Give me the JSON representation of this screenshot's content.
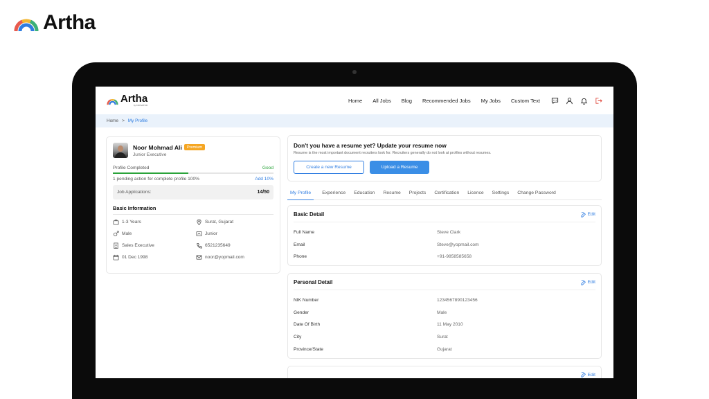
{
  "brand": {
    "name": "Artha"
  },
  "app": {
    "logo": {
      "name": "Artha",
      "sub": "by KNOVATOR"
    },
    "nav": [
      "Home",
      "All Jobs",
      "Blog",
      "Recommended Jobs",
      "My Jobs",
      "Custom Text"
    ],
    "nav_icons": [
      "chat-icon",
      "user-icon",
      "bell-icon",
      "logout-icon"
    ],
    "breadcrumb": {
      "home": "Home",
      "separator": ">",
      "current": "My Profile"
    },
    "colors": {
      "accent": "#2f7de1",
      "good": "#2aa33a",
      "premium": "#f5a623",
      "breadcrumb_bg": "#eaf2fb"
    }
  },
  "profile": {
    "name": "Noor Mohmad Ali",
    "badge": "Premium",
    "role": "Junior Executive",
    "completed_label": "Profile Completed",
    "completed_status": "Good",
    "completed_fraction": 0.47,
    "pending_text": "1 pending action for complete profile 100%",
    "add_text": "Add 10%",
    "job_apps_label": "Job Applications:",
    "job_apps_value": "14/50",
    "basic_info_title": "Basic Information",
    "basic_info": [
      {
        "icon": "briefcase-icon",
        "text": "1-3 Years"
      },
      {
        "icon": "location-icon",
        "text": "Surat, Gujarat"
      },
      {
        "icon": "gender-male-icon",
        "text": "Male"
      },
      {
        "icon": "level-icon",
        "text": "Junior"
      },
      {
        "icon": "building-icon",
        "text": "Sales Executive"
      },
      {
        "icon": "phone-icon",
        "text": "6521235649"
      },
      {
        "icon": "calendar-icon",
        "text": "01 Dec 1998"
      },
      {
        "icon": "mail-icon",
        "text": "noor@yopmail.com"
      }
    ]
  },
  "resume": {
    "title": "Don't you have a resume yet? Update your resume now",
    "subtitle": "Resume is the most important document recruiters look for. Recruiters generally do not look at profiles without resumes.",
    "create_button": "Create a new Resume",
    "upload_button": "Upload a Resume"
  },
  "tabs": [
    "My Profile",
    "Experience",
    "Education",
    "Resume",
    "Projects",
    "Certification",
    "Licence",
    "Settings",
    "Change Password"
  ],
  "basic_detail": {
    "title": "Basic Detail",
    "edit": "Edit",
    "rows": [
      {
        "label": "Full Name",
        "value": "Steve Clark"
      },
      {
        "label": "Email",
        "value": "Steve@yopmail.com"
      },
      {
        "label": "Phone",
        "value": "+91-9858585658"
      }
    ]
  },
  "personal_detail": {
    "title": "Personal Detail",
    "edit": "Edit",
    "rows": [
      {
        "label": "NIK Number",
        "value": "1234567890123456"
      },
      {
        "label": "Gender",
        "value": "Male"
      },
      {
        "label": "Date Of Birth",
        "value": "11 May 2010"
      },
      {
        "label": "City",
        "value": "Surat"
      },
      {
        "label": "Province/State",
        "value": "Gujarat"
      }
    ]
  },
  "next_section": {
    "edit": "Edit"
  }
}
